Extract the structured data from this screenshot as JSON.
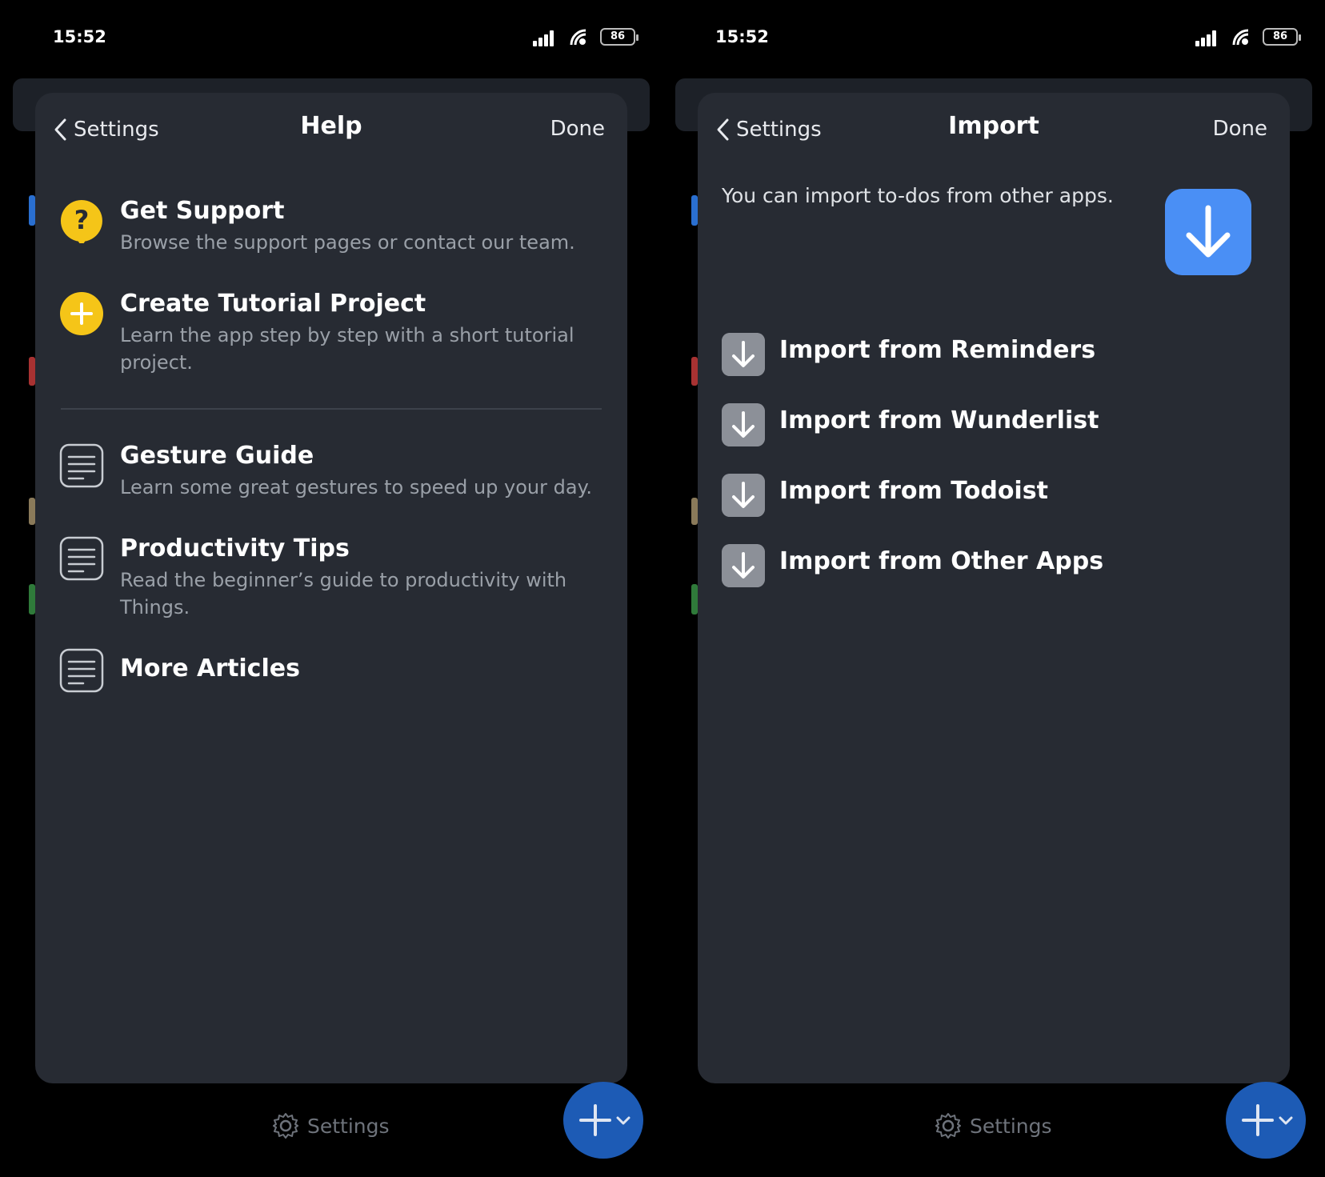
{
  "left": {
    "status": {
      "time": "15:52",
      "battery": "86"
    },
    "nav": {
      "back_label": "Settings",
      "title": "Help",
      "done_label": "Done"
    },
    "items": [
      {
        "title": "Get Support",
        "subtitle": "Browse the support pages or contact our team.",
        "icon": "help-icon"
      },
      {
        "title": "Create Tutorial Project",
        "subtitle": "Learn the app step by step with a short tutorial project.",
        "icon": "add-icon"
      },
      {
        "title": "Gesture Guide",
        "subtitle": "Learn some great gestures to speed up your day.",
        "icon": "document-icon"
      },
      {
        "title": "Productivity Tips",
        "subtitle": "Read the beginner’s guide to productivity with Things.",
        "icon": "document-icon"
      },
      {
        "title": "More Articles",
        "subtitle": "",
        "icon": "document-icon"
      }
    ],
    "bottom": {
      "settings_label": "Settings"
    }
  },
  "right": {
    "status": {
      "time": "15:52",
      "battery": "86"
    },
    "nav": {
      "back_label": "Settings",
      "title": "Import",
      "done_label": "Done"
    },
    "description": "You can import to-dos from other apps.",
    "items": [
      {
        "label": "Import from Reminders",
        "icon": "download-icon"
      },
      {
        "label": "Import from Wunderlist",
        "icon": "download-icon"
      },
      {
        "label": "Import from Todoist",
        "icon": "download-icon"
      },
      {
        "label": "Import from Other Apps",
        "icon": "download-icon"
      }
    ],
    "bottom": {
      "settings_label": "Settings"
    }
  },
  "colors": {
    "background": "#000000",
    "sheet": "#272b33",
    "accent_yellow": "#f5c518",
    "accent_blue": "#4a8ff5",
    "fab_blue": "#1d5bb5",
    "muted_text": "#9aa0a8"
  }
}
